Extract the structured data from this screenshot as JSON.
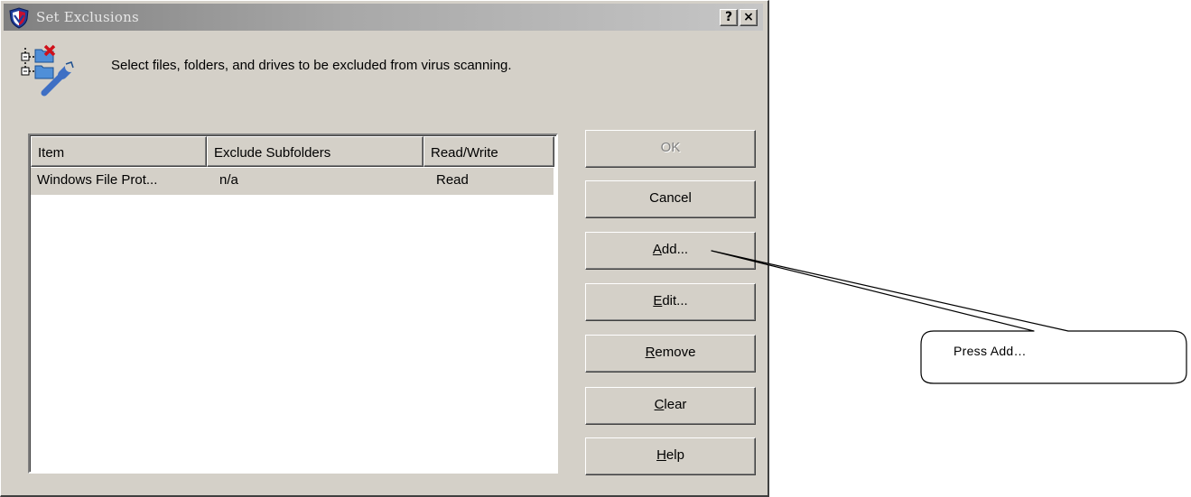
{
  "dialog": {
    "title": "Set Exclusions",
    "help_button": "?",
    "close_button": "×",
    "header_text": "Select files, folders, and drives to be excluded from virus scanning."
  },
  "list": {
    "columns": [
      "Item",
      "Exclude Subfolders",
      "Read/Write"
    ],
    "rows": [
      {
        "item": "Windows File Prot...",
        "subfolders": "n/a",
        "access": "Read"
      }
    ]
  },
  "buttons": {
    "ok": "OK",
    "cancel": "Cancel",
    "add": {
      "hot": "A",
      "rest": "dd..."
    },
    "edit": {
      "hot": "E",
      "rest": "dit..."
    },
    "remove": {
      "hot": "R",
      "rest": "emove"
    },
    "clear": {
      "hot": "C",
      "rest": "lear"
    },
    "help": {
      "hot": "H",
      "rest": "elp"
    }
  },
  "callout": {
    "text": "Press Add…"
  },
  "colors": {
    "dialog_face": "#d4d0c8",
    "title_gradient_start": "#808080",
    "title_gradient_end": "#c6c6c6",
    "disabled_text": "#808080"
  },
  "icons": {
    "app": "shield-icon",
    "header": "exclusion-tree-icon"
  }
}
